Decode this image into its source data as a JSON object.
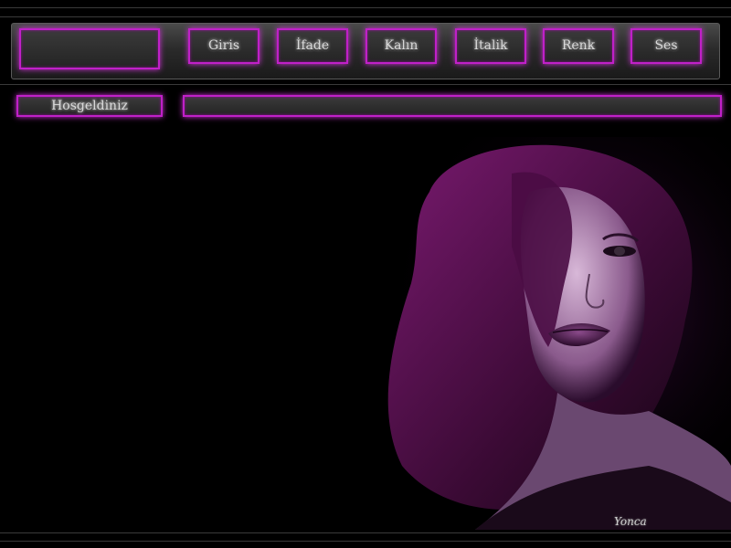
{
  "nav": {
    "items": [
      {
        "label": "Giris"
      },
      {
        "label": "İfade"
      },
      {
        "label": "Kalın"
      },
      {
        "label": "İtalik"
      },
      {
        "label": "Renk"
      },
      {
        "label": "Ses"
      }
    ]
  },
  "welcome": {
    "label": "Hosgeldiniz"
  },
  "signature": "Yonca",
  "colors": {
    "accent": "#c020c8",
    "background": "#000000",
    "text": "#d8d8d8"
  }
}
